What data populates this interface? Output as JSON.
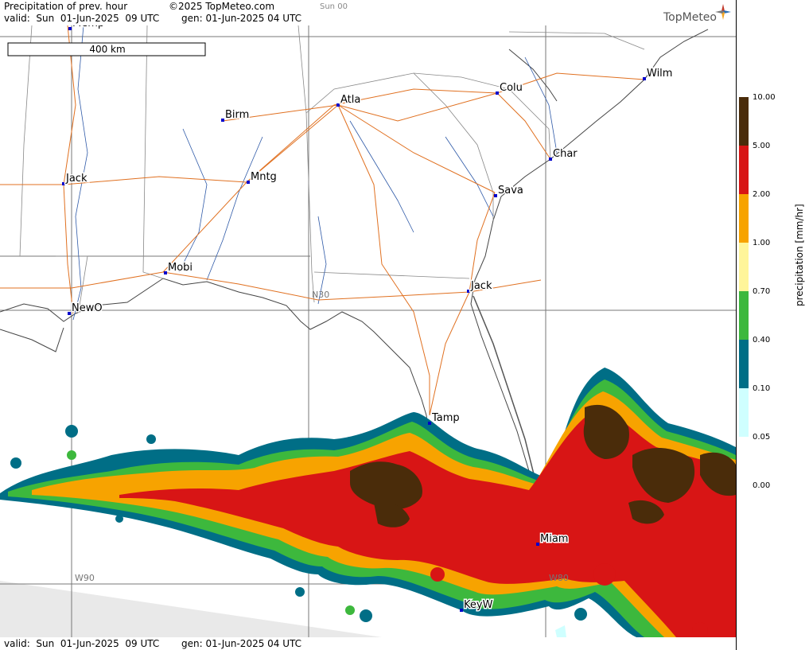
{
  "header": {
    "title": "Precipitation of prev. hour",
    "copyright": "©2025 TopMeteo.com",
    "run": "Sun 00",
    "valid": "valid:  Sun  01-Jun-2025  09 UTC",
    "gen": "gen: 01-Jun-2025 04 UTC",
    "logo": "TopMeteo"
  },
  "footer": {
    "valid": "valid:  Sun  01-Jun-2025  09 UTC",
    "gen": "gen: 01-Jun-2025 04 UTC"
  },
  "map": {
    "scale_label": "400 km",
    "grid_labels": {
      "lat": "N30",
      "lon_west": "W90",
      "lon_east": "W80"
    },
    "cities": [
      {
        "name": "Mmp",
        "label": "Memp"
      },
      {
        "name": "Birm",
        "label": "Birm"
      },
      {
        "name": "Atla",
        "label": "Atla"
      },
      {
        "name": "Colu",
        "label": "Colu"
      },
      {
        "name": "Wilm",
        "label": "Wilm"
      },
      {
        "name": "Char",
        "label": "Char"
      },
      {
        "name": "Jack-ms",
        "label": "Jack"
      },
      {
        "name": "Mntg",
        "label": "Mntg"
      },
      {
        "name": "Sava",
        "label": "Sava"
      },
      {
        "name": "Mobi",
        "label": "Mobi"
      },
      {
        "name": "Jack-fl",
        "label": "Jack"
      },
      {
        "name": "NewO",
        "label": "NewO"
      },
      {
        "name": "Tamp",
        "label": "Tamp"
      },
      {
        "name": "Miam",
        "label": "Miam"
      },
      {
        "name": "KeyW",
        "label": "KeyW"
      }
    ]
  },
  "legend": {
    "unit": "precipitation [mm/hr]",
    "ticks": [
      "10.00",
      "5.00",
      "2.00",
      "1.00",
      "0.70",
      "0.40",
      "0.10",
      "0.05",
      "0.00"
    ],
    "colors": [
      "#4a2c0a",
      "#d81515",
      "#f7a300",
      "#fff59a",
      "#3db83d",
      "#006e86",
      "#cfffff",
      "#ffffff"
    ]
  }
}
